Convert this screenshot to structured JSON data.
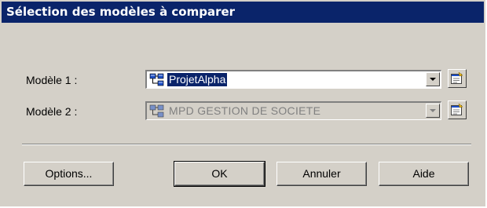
{
  "dialog": {
    "title": "Sélection des modèles à comparer"
  },
  "model1": {
    "label": "Modèle 1 :",
    "value": "ProjetAlpha",
    "icon": "model-tree-icon"
  },
  "model2": {
    "label": "Modèle 2 :",
    "value": "MPD GESTION DE SOCIETE",
    "icon": "model-tree-icon"
  },
  "buttons": {
    "options": "Options...",
    "ok": "OK",
    "cancel": "Annuler",
    "help": "Aide"
  },
  "colors": {
    "titlebar": "#0a246a",
    "face": "#d4d0c8"
  }
}
